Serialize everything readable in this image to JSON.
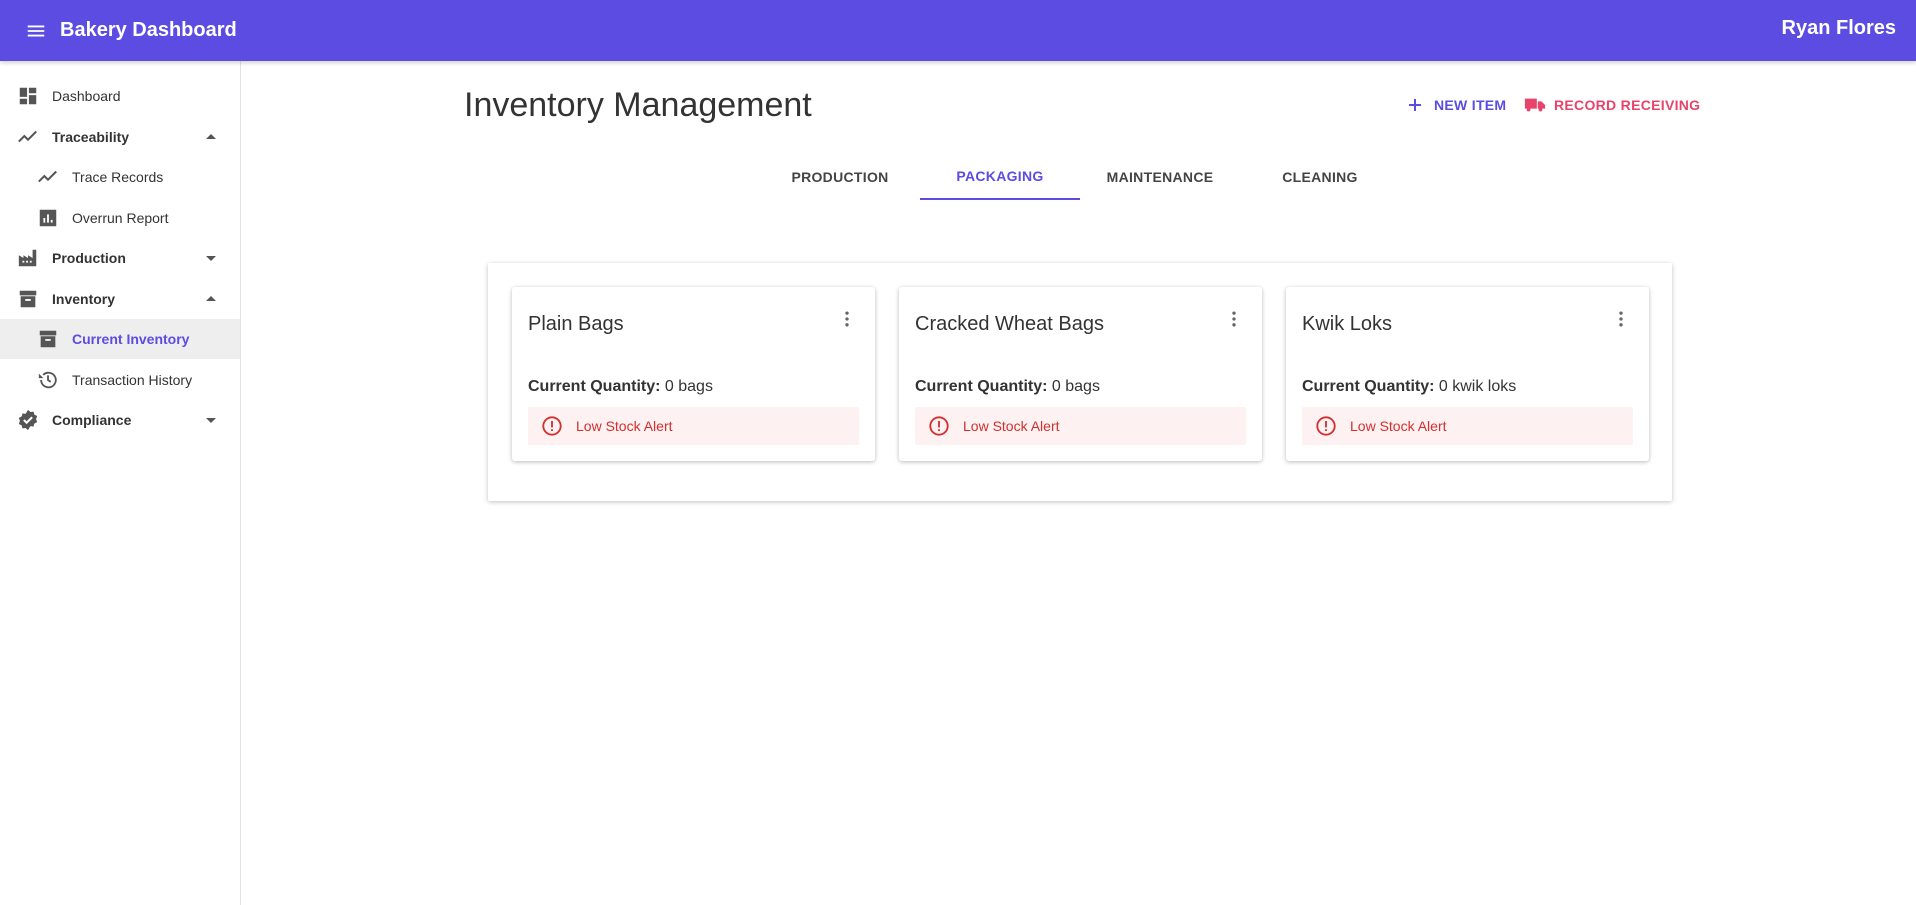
{
  "appbar": {
    "title": "Bakery Dashboard",
    "user": "Ryan Flores",
    "menu_icon": "hamburger-menu-icon",
    "color": "#5c4ce1"
  },
  "sidebar": {
    "items": [
      {
        "label": "Dashboard",
        "icon": "dashboard-icon",
        "level": "top"
      },
      {
        "label": "Traceability",
        "icon": "trending-line-icon",
        "level": "top",
        "expanded": true
      },
      {
        "label": "Trace Records",
        "icon": "trending-line-icon",
        "level": "sub"
      },
      {
        "label": "Overrun Report",
        "icon": "bar-chart-icon",
        "level": "sub"
      },
      {
        "label": "Production",
        "icon": "factory-icon",
        "level": "top",
        "expanded": false
      },
      {
        "label": "Inventory",
        "icon": "archive-icon",
        "level": "top",
        "expanded": true
      },
      {
        "label": "Current Inventory",
        "icon": "archive-icon",
        "level": "sub",
        "active": true
      },
      {
        "label": "Transaction History",
        "icon": "history-icon",
        "level": "sub"
      },
      {
        "label": "Compliance",
        "icon": "verified-badge-icon",
        "level": "top",
        "expanded": false
      }
    ]
  },
  "main": {
    "title": "Inventory Management",
    "actions": {
      "new_item": "NEW ITEM",
      "record_receiving": "RECORD RECEIVING"
    },
    "tabs": [
      {
        "label": "PRODUCTION",
        "active": false
      },
      {
        "label": "PACKAGING",
        "active": true
      },
      {
        "label": "MAINTENANCE",
        "active": false
      },
      {
        "label": "CLEANING",
        "active": false
      }
    ],
    "cards": [
      {
        "title": "Plain Bags",
        "qty_label": "Current Quantity:",
        "qty_value": "0 bags",
        "alert": "Low Stock Alert"
      },
      {
        "title": "Cracked Wheat Bags",
        "qty_label": "Current Quantity:",
        "qty_value": "0 bags",
        "alert": "Low Stock Alert"
      },
      {
        "title": "Kwik Loks",
        "qty_label": "Current Quantity:",
        "qty_value": "0 kwik loks",
        "alert": "Low Stock Alert"
      }
    ]
  },
  "colors": {
    "primary": "#5c4ce1",
    "secondary": "#e8436b",
    "alert": "#d32f2f",
    "alert_bg": "#fdf1f1"
  }
}
